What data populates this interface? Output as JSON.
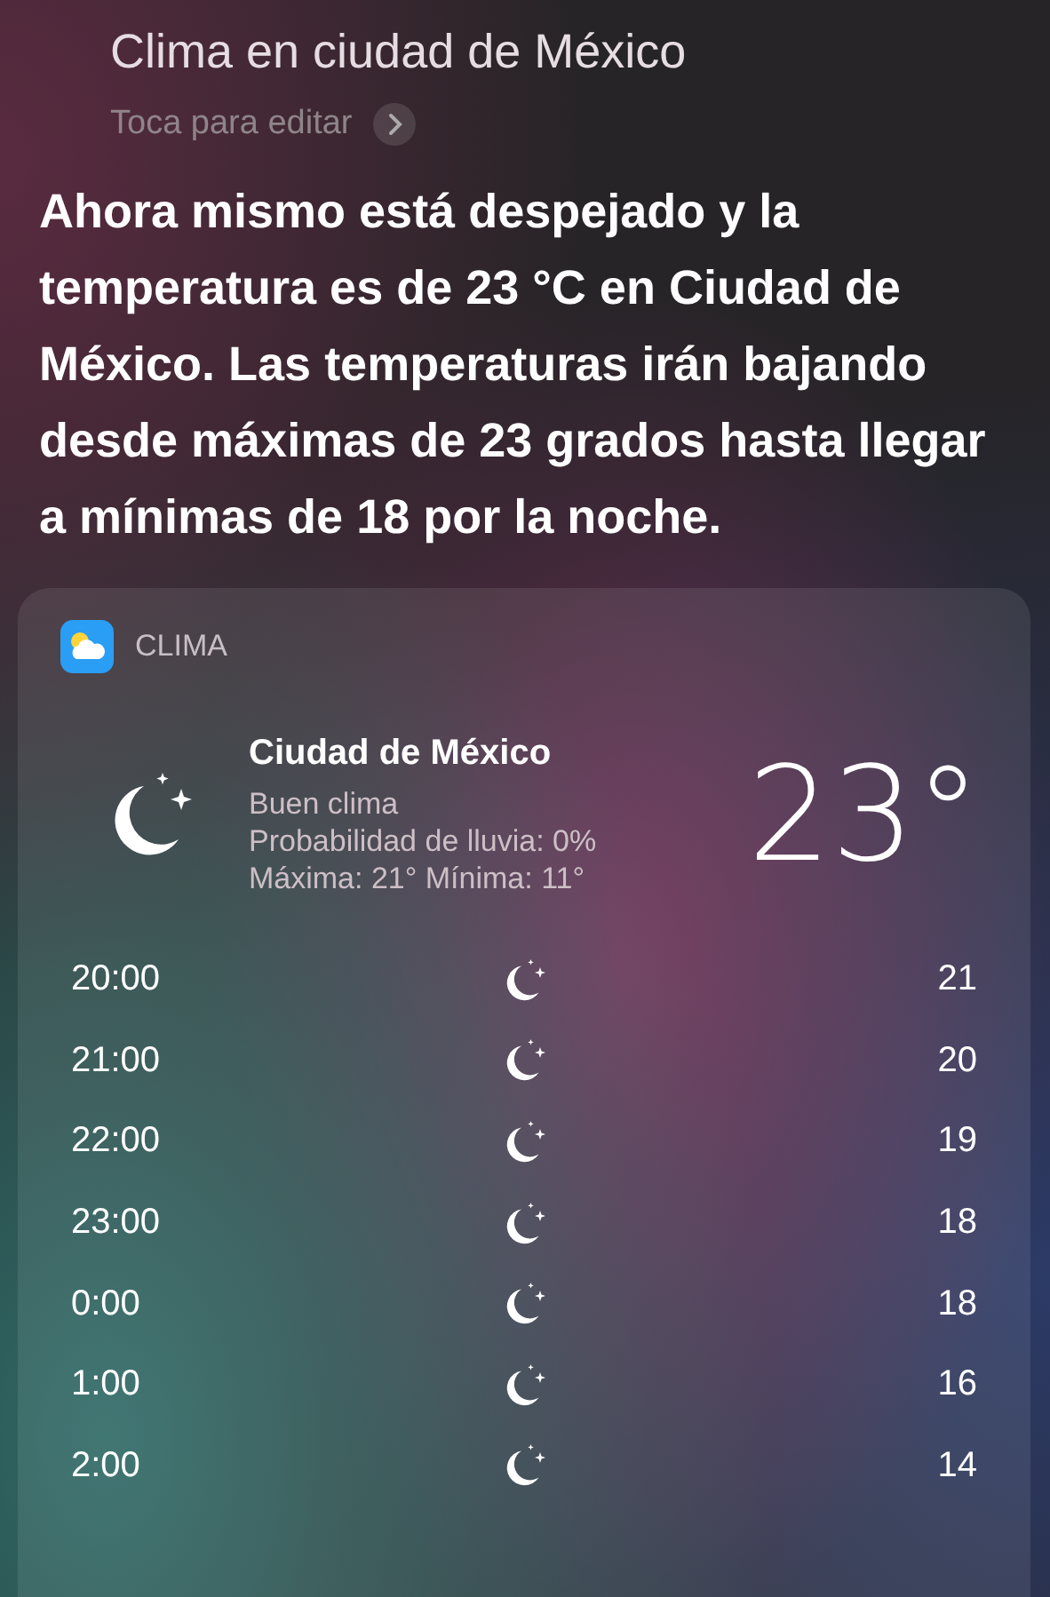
{
  "query": {
    "text": "Clima en ciudad de México",
    "hint": "Toca para editar"
  },
  "response": "Ahora mismo está despejado y la temperatura es de 23 °C en Ciudad de México. Las temperaturas irán bajando desde máximas de 23 grados hasta llegar a mínimas de 18 por la noche.",
  "card": {
    "app": "CLIMA",
    "city": "Ciudad de México",
    "details": [
      "Buen clima",
      "Probabilidad de lluvia: 0%",
      "Máxima: 21° Mínima: 11°"
    ],
    "temperature": "23°",
    "hours": [
      {
        "time": "20:00",
        "temp": "21"
      },
      {
        "time": "21:00",
        "temp": "20"
      },
      {
        "time": "22:00",
        "temp": "19"
      },
      {
        "time": "23:00",
        "temp": "18"
      },
      {
        "time": "0:00",
        "temp": "18"
      },
      {
        "time": "1:00",
        "temp": "16"
      },
      {
        "time": "2:00",
        "temp": "14"
      }
    ]
  }
}
